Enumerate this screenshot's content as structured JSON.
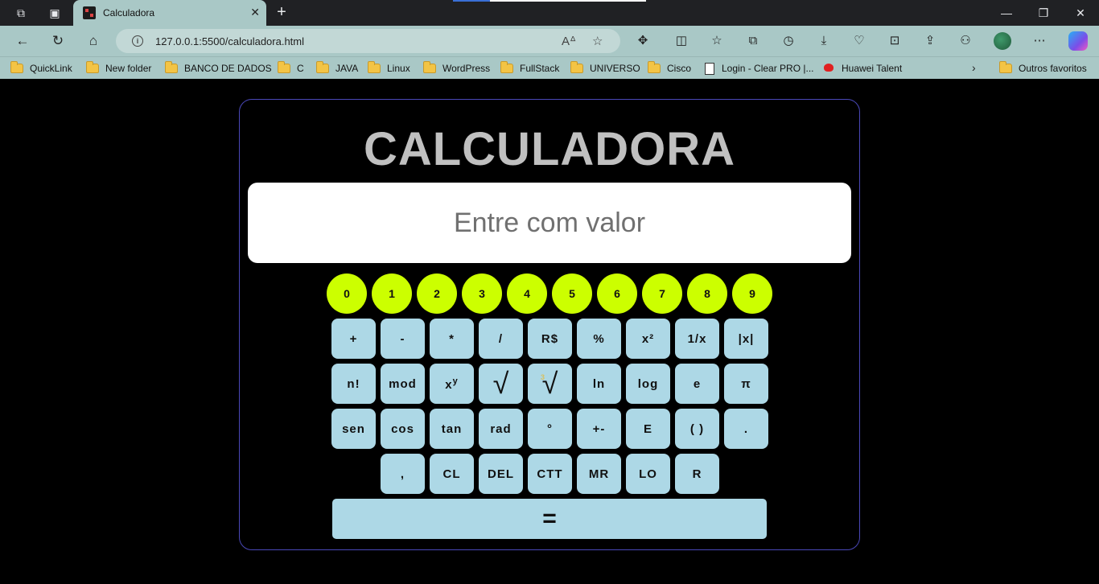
{
  "tab": {
    "title": "Calculadora",
    "close": "✕"
  },
  "address": {
    "url": "127.0.0.1:5500/calculadora.html"
  },
  "bookmarks": [
    "QuickLink",
    "New folder",
    "BANCO DE DADOS",
    "C",
    "JAVA",
    "Linux",
    "WordPress",
    "FullStack",
    "UNIVERSO",
    "Cisco",
    "Login - Clear PRO |...",
    "Huawei Talent",
    "Outros favoritos"
  ],
  "calc": {
    "title": "CALCULADORA",
    "placeholder": "Entre com valor",
    "digits": [
      "0",
      "1",
      "2",
      "3",
      "4",
      "5",
      "6",
      "7",
      "8",
      "9"
    ],
    "row1": [
      "+",
      "-",
      "*",
      "/",
      "R$",
      "%",
      "x²",
      "1/x",
      "|x|"
    ],
    "row2": [
      "n!",
      "mod",
      "xy_sup",
      "√",
      "∛",
      "ln",
      "log",
      "e",
      "π"
    ],
    "row2_xy": {
      "base": "x",
      "exp": "y"
    },
    "row2_sqrt": "√",
    "row2_cbrt": "√",
    "row2_cbrt_index": "3",
    "row3": [
      "sen",
      "cos",
      "tan",
      "rad",
      "°",
      "+-",
      "E",
      "( )",
      "."
    ],
    "row4": [
      ",",
      "CL",
      "DEL",
      "CTT",
      "MR",
      "LO",
      "R"
    ],
    "equals": "="
  },
  "colors": {
    "digit_bg": "#ccff00",
    "key_bg": "#add8e6",
    "title": "#c0c0c0",
    "border": "#4a48b8",
    "page_bg": "#000000"
  }
}
